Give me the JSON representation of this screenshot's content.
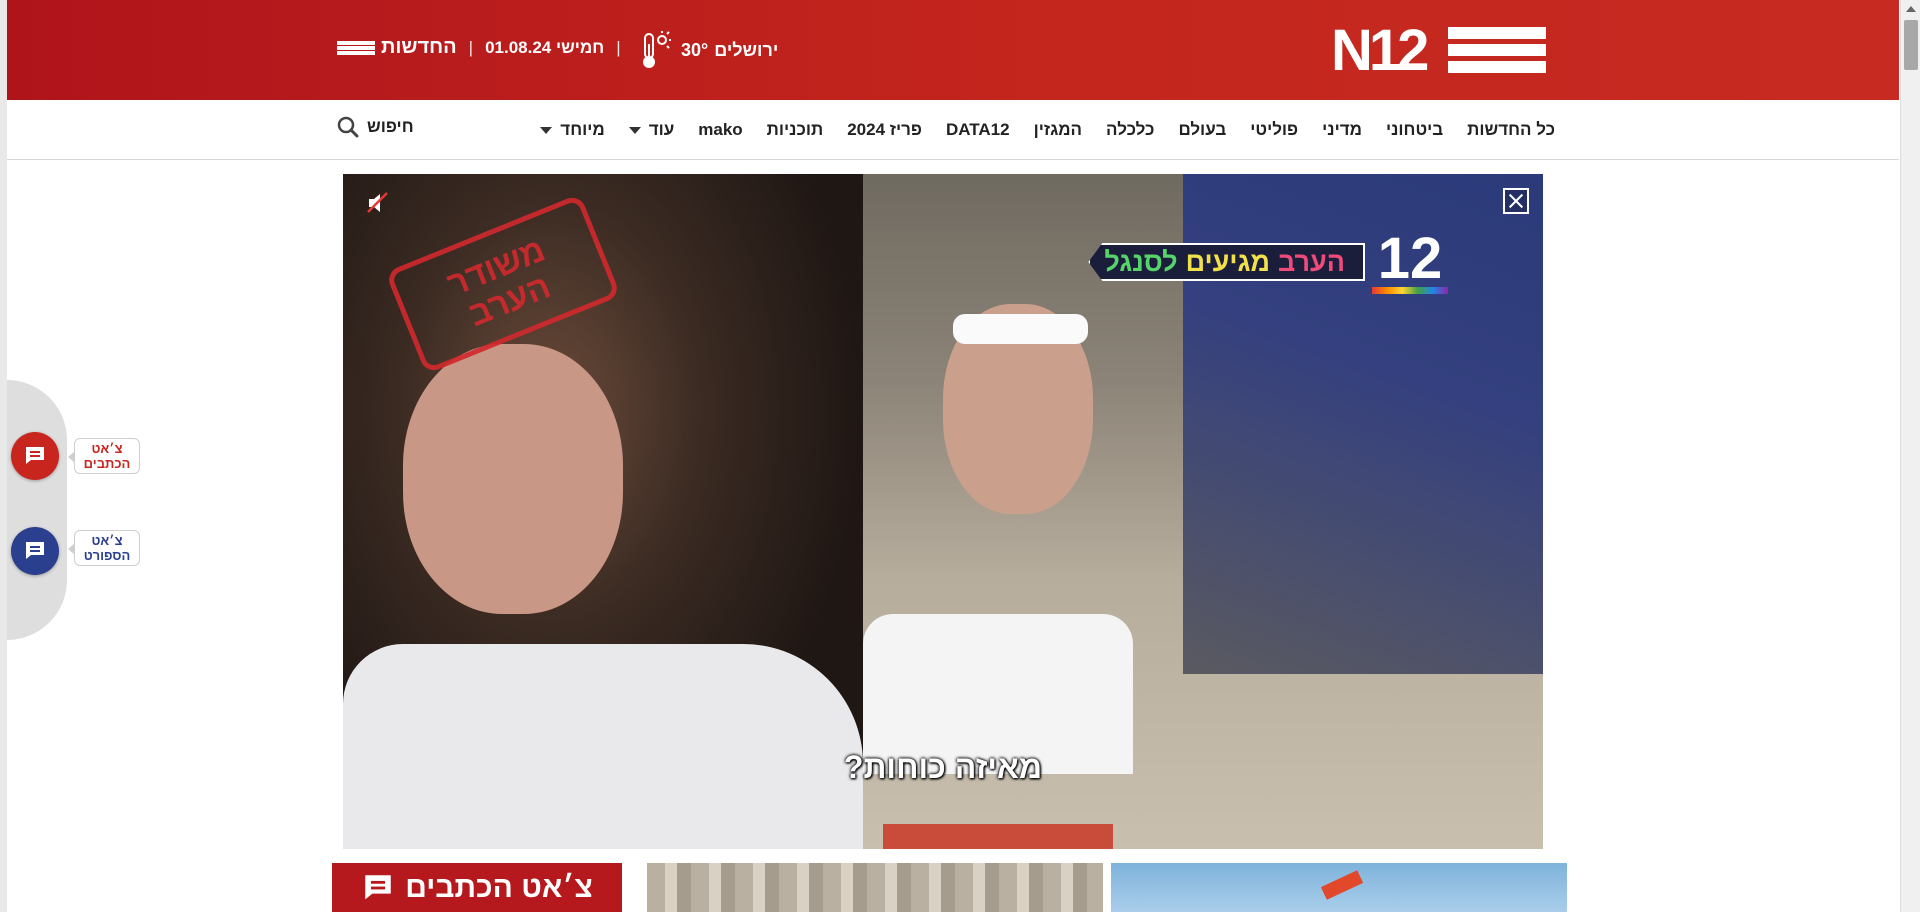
{
  "header": {
    "logo_text": "N12",
    "weather": {
      "city": "ירושלים",
      "temperature": "30°"
    },
    "date_text": "חמישי 01.08.24",
    "news_brand": "החדשות",
    "separator": "|",
    "brand_color": "#c4261d"
  },
  "nav": {
    "items": [
      {
        "label": "כל החדשות"
      },
      {
        "label": "ביטחוני"
      },
      {
        "label": "מדיני"
      },
      {
        "label": "פוליטי"
      },
      {
        "label": "בעולם"
      },
      {
        "label": "כלכלה"
      },
      {
        "label": "המגזין"
      },
      {
        "label": "DATA12"
      },
      {
        "label": "פריז 2024"
      },
      {
        "label": "תוכניות"
      },
      {
        "label": "mako"
      },
      {
        "label": "עוד"
      },
      {
        "label": "מיוחד"
      }
    ],
    "search_label": "חיפוש"
  },
  "video": {
    "stamp_line1": "משודר",
    "stamp_line2": "הערב",
    "promo_word1": "הערב",
    "promo_word2": "מגיעים",
    "promo_word3": "לסנגל",
    "promo_logo": "12",
    "subtitle": "מאיזה כוחות?",
    "muted": true
  },
  "side_chats": {
    "newsroom": {
      "line1": "צ׳אט",
      "line2": "הכתבים",
      "color": "#c8251e"
    },
    "sports": {
      "line1": "צ׳אט",
      "line2": "הספורט",
      "color": "#2b3f8f"
    }
  },
  "cards": {
    "chat_title": "צ׳אט הכתבים"
  }
}
